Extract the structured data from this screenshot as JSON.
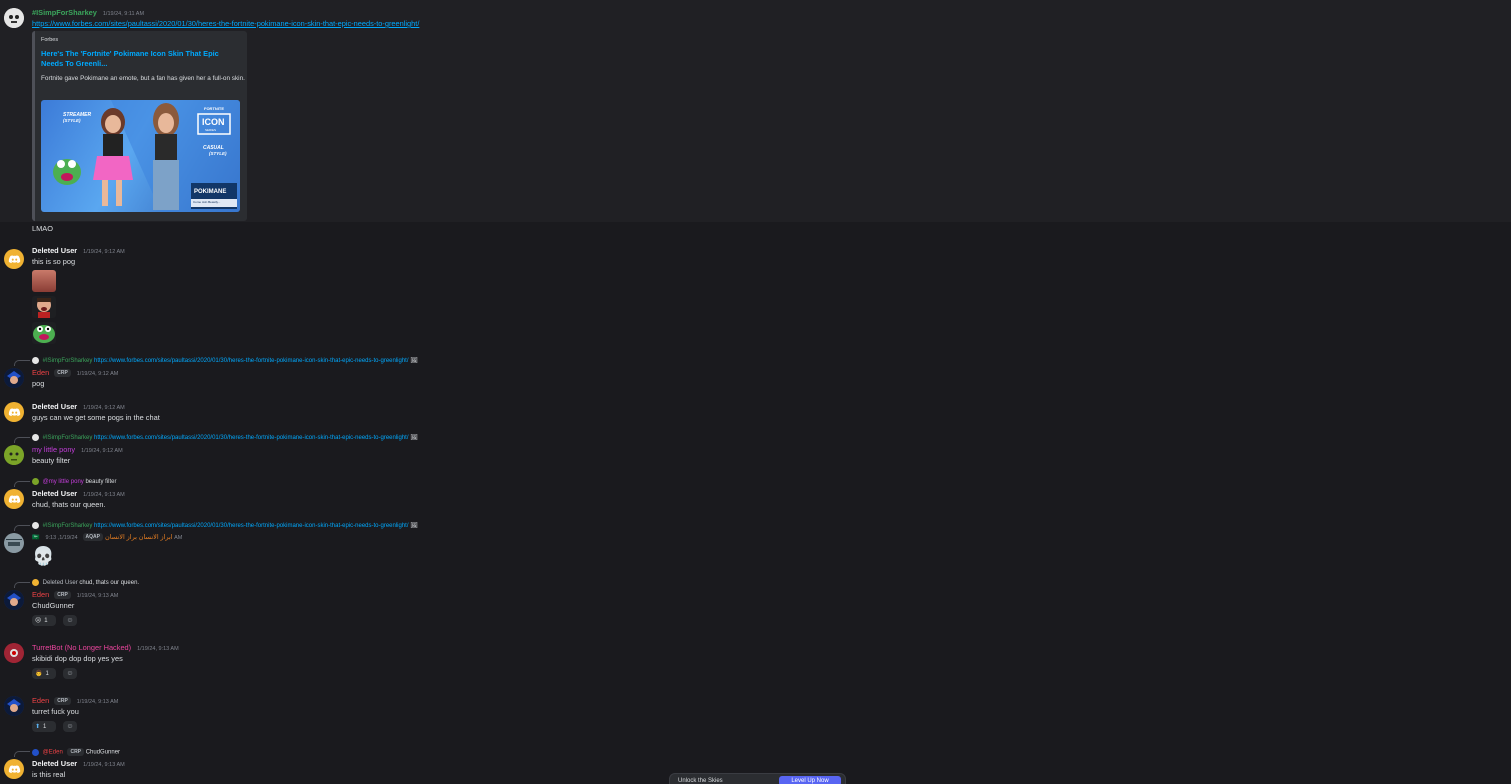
{
  "toolbar": {
    "icons": [
      "broken-heart-reaction",
      "gem-reaction",
      "question-reaction",
      "add-reaction",
      "reply",
      "forward",
      "more"
    ]
  },
  "messages": [
    {
      "author": "#ISimpForSharkey",
      "author_color": "#3ba55c",
      "timestamp": "1/19/24, 9:11 AM",
      "link": "https://www.forbes.com/sites/paultassi/2020/01/30/heres-the-fortnite-pokimane-icon-skin-that-epic-needs-to-greenlight/",
      "embed": {
        "provider": "Forbes",
        "title": "Here's The 'Fortnite' Pokimane Icon Skin That Epic Needs To Greenli...",
        "description": "Fortnite gave Pokimane an emote, but a fan has given her a full-on skin.",
        "image_labels": {
          "streamer": "STREAMER",
          "streamer_style": "(STYLE)",
          "casual": "CASUAL",
          "casual_style": "(STYLE)",
          "fortnite": "FORTNITE",
          "icon": "ICON",
          "series": "SERIES",
          "name": "POKIMANE",
          "caption": "Come Join Beastly..."
        }
      },
      "followup": "LMAO"
    },
    {
      "author": "Deleted User",
      "timestamp": "1/19/24, 9:12 AM",
      "content": "this is so pog"
    },
    {
      "reply_to": {
        "author": "#ISimpForSharkey",
        "link": "https://www.forbes.com/sites/paultassi/2020/01/30/heres-the-fortnite-pokimane-icon-skin-that-epic-needs-to-greenlight/"
      },
      "author": "Eden",
      "author_color": "#ed4245",
      "tag": "CRP",
      "timestamp": "1/19/24, 9:12 AM",
      "content": "pog"
    },
    {
      "author": "Deleted User",
      "timestamp": "1/19/24, 9:12 AM",
      "content": "guys can we get some pogs in the chat"
    },
    {
      "reply_to": {
        "author": "#ISimpForSharkey",
        "link": "https://www.forbes.com/sites/paultassi/2020/01/30/heres-the-fortnite-pokimane-icon-skin-that-epic-needs-to-greenlight/"
      },
      "author": "my little pony",
      "author_color": "#c33ed9",
      "timestamp": "1/19/24, 9:12 AM",
      "content": "beauty filter"
    },
    {
      "reply_to": {
        "author": "@my little pony",
        "text": "beauty filter"
      },
      "author": "Deleted User",
      "timestamp": "1/19/24, 9:13 AM",
      "content": "chud, thats our queen."
    },
    {
      "reply_to": {
        "author": "#ISimpForSharkey",
        "link": "https://www.forbes.com/sites/paultassi/2020/01/30/heres-the-fortnite-pokimane-icon-skin-that-epic-needs-to-greenlight/"
      },
      "author": "ابراز الانسان براز الانسان",
      "author_color": "#e67e22",
      "tag": "AQAP",
      "timestamp": "1/19/24, 9:13 AM",
      "content": "💀"
    },
    {
      "reply_to": {
        "author": "Deleted User",
        "text": "chud, thats our queen."
      },
      "author": "Eden",
      "author_color": "#ed4245",
      "tag": "CRP",
      "timestamp": "1/19/24, 9:13 AM",
      "content": "ChudGunner",
      "reaction": {
        "emoji": "😢",
        "count": "1"
      }
    },
    {
      "author": "TurretBot (No Longer Hacked)",
      "author_color": "#eb459e",
      "timestamp": "1/19/24, 9:13 AM",
      "content": "skibidi dop dop dop yes yes",
      "reaction": {
        "emoji": "👨",
        "count": "1"
      }
    },
    {
      "author": "Eden",
      "author_color": "#ed4245",
      "tag": "CRP",
      "timestamp": "1/19/24, 9:13 AM",
      "content": "turret fuck you",
      "reaction": {
        "emoji": "⬆",
        "count": "1"
      }
    },
    {
      "reply_to": {
        "author": "@Eden",
        "tag": "CRP",
        "text": "ChudGunner"
      },
      "author": "Deleted User",
      "timestamp": "1/19/24, 9:13 AM",
      "content": "is this real"
    }
  ],
  "bottom_bar": {
    "text": "Unlock the Skies",
    "button": "Level Up Now"
  }
}
